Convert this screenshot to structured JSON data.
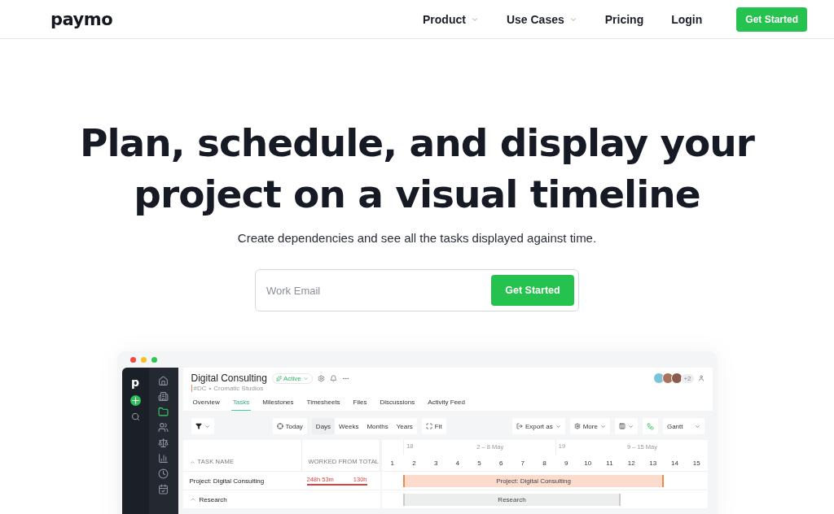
{
  "nav": {
    "logo": "paymo",
    "links": [
      {
        "label": "Product",
        "dropdown": true
      },
      {
        "label": "Use Cases",
        "dropdown": true
      },
      {
        "label": "Pricing",
        "dropdown": false
      },
      {
        "label": "Login",
        "dropdown": false
      }
    ],
    "cta": "Get Started"
  },
  "hero": {
    "title": "Plan, schedule, and display your project on a visual timeline",
    "subtitle": "Create dependencies and see all the tasks displayed against time.",
    "form": {
      "placeholder": "Work Email",
      "button": "Get Started"
    }
  },
  "app": {
    "logo": "p",
    "sidebar": {
      "items": [
        {
          "selected": false
        },
        {
          "selected": false
        },
        {
          "selected": true
        },
        {
          "selected": false
        },
        {
          "selected": false
        },
        {
          "selected": false
        },
        {
          "selected": false
        },
        {
          "selected": false
        }
      ]
    },
    "project": {
      "title": "Digital Consulting",
      "status": "Active",
      "code": "#DC",
      "separator": "•",
      "client": "Cromatic Studios",
      "members_extra": "+2"
    },
    "tabs": [
      {
        "label": "Overview",
        "selected": false
      },
      {
        "label": "Tasks",
        "selected": true
      },
      {
        "label": "Milestones",
        "selected": false
      },
      {
        "label": "Timesheets",
        "selected": false
      },
      {
        "label": "Files",
        "selected": false
      },
      {
        "label": "Discussions",
        "selected": false
      },
      {
        "label": "Activity Feed",
        "selected": false
      }
    ],
    "toolbar": {
      "today": "Today",
      "scales": [
        {
          "label": "Days",
          "selected": true
        },
        {
          "label": "Weeks",
          "selected": false
        },
        {
          "label": "Months",
          "selected": false
        },
        {
          "label": "Years",
          "selected": false
        }
      ],
      "fit": "Fit",
      "export": "Export as",
      "more": "More",
      "view": "Gantt"
    },
    "table": {
      "columns": [
        "TASK NAME",
        "WORKED FROM TOTAL"
      ],
      "weeks": [
        {
          "number": "18",
          "range": "2 – 8 May"
        },
        {
          "number": "19",
          "range": "9 – 15 May"
        }
      ],
      "days": [
        "1",
        "2",
        "3",
        "4",
        "5",
        "6",
        "7",
        "8",
        "9",
        "10",
        "11",
        "12",
        "13",
        "14",
        "15"
      ],
      "rows": [
        {
          "kind": "project",
          "name": "Project: Digital Consulting",
          "worked": "248h 53m",
          "total": "130h",
          "level": 1,
          "bar": "Project: Digital Consulting"
        },
        {
          "kind": "group",
          "name": "Research",
          "expanded": true,
          "bar": "Research"
        }
      ]
    }
  }
}
